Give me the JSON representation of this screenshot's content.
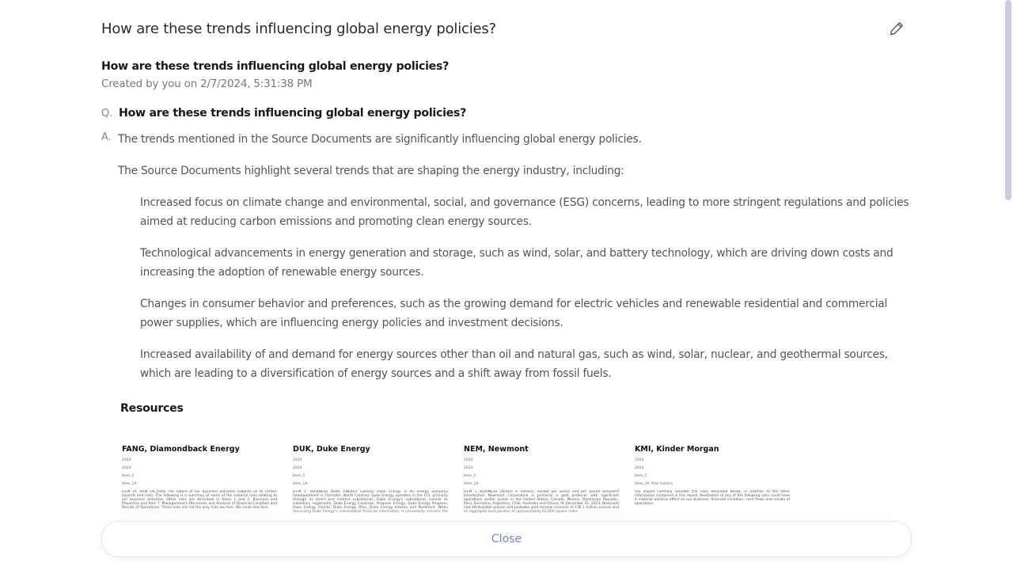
{
  "header": {
    "title": "How are these trends influencing global energy policies?",
    "edit_icon": "pencil-icon"
  },
  "conversation": {
    "title": "How are these trends influencing global energy policies?",
    "meta": "Created by you on 2/7/2024, 5:31:38 PM"
  },
  "qa": {
    "q_marker": "Q.",
    "question": "How are these trends influencing global energy policies?",
    "a_marker": "A.",
    "answer_intro": "The trends mentioned in the Source Documents are significantly influencing global energy policies.",
    "answer_lead": "The Source Documents highlight several trends that are shaping the energy industry, including:",
    "bullets": [
      "Increased focus on climate change and environmental, social, and governance (ESG) concerns, leading to more stringent regulations and policies aimed at reducing carbon emissions and promoting clean energy sources.",
      "Technological advancements in energy generation and storage, such as wind, solar, and battery technology, which are driving down costs and increasing the adoption of renewable energy sources.",
      "Changes in consumer behavior and preferences, such as the growing demand for electric vehicles and renewable residential and commercial power supplies, which are influencing energy policies and investment decisions.",
      "Increased availability of and demand for energy sources other than oil and natural gas, such as wind, solar, nuclear, and geothermal sources, which are leading to a diversification of energy sources and a shift away from fossil fuels."
    ]
  },
  "resources": {
    "title": "Resources",
    "items": [
      {
        "title": "FANG, Diamondback Energy",
        "line1": "2023",
        "line2": "2023",
        "line3": "Item_1",
        "line4": "Item_1A",
        "body": "ITEM 1A. RISK FACTORS The nature of our business activities subjects us to certain hazards and risks. The following is a summary of some of the material risks relating to our business activities. Other risks are described in Items 1 and 2. Business and Properties and Item 7. Management's Discussion and Analysis of Financial Condition and Results of Operations. These risks are not the only risks we face. We could also face"
      },
      {
        "title": "DUK, Duke Energy",
        "line1": "2023",
        "line2": "2023",
        "line3": "Item_1",
        "line4": "Item_1A",
        "body": "ITEM 1. BUSINESS DUKE ENERGY General Duke Energy is an energy company headquartered in Charlotte, North Carolina. Duke Energy operates in the U.S. primarily through its direct and indirect subsidiaries. Duke Energy's subsidiaries include its subsidiary registrants, Duke Energy Carolinas, Progress Energy, Duke Energy Progress, Duke Energy Florida, Duke Energy Ohio, Duke Energy Indiana and Piedmont. When discussing Duke Energy's consolidated financial information, it necessarily includes the results of its"
      },
      {
        "title": "NEM, Newmont",
        "line1": "2023",
        "line2": "2023",
        "line3": "Item_1",
        "line4": "Item_1A",
        "body": "ITEM 1. BUSINESS (dollars in millions, except per ounce and per pound amounts) Introduction Newmont Corporation is primarily a gold producer with significant operations and/or assets in the United States, Canada, Mexico, Dominican Republic, Peru, Suriname, Argentina, Chile, Australia and Ghana. At December 31, 2023, Newmont had attributable proven and probable gold mineral reserves of 136.1 million ounces and an aggregate land position of approximately 62,000 square miles"
      },
      {
        "title": "KMI, Kinder Morgan",
        "line1": "2023",
        "line2": "2023",
        "line3": "Item_1",
        "line4": "Item_1A. Risk Factors",
        "body": "You should carefully consider the risks described below, in addition to the other information contained in this report. Realization of any of the following risks could have a material adverse effect on our business, financial condition, cash flows and results of operations."
      }
    ]
  },
  "footer": {
    "close_label": "Close"
  },
  "colors": {
    "accent": "#7b7fc4",
    "scrollbar": "#c9cce6"
  }
}
